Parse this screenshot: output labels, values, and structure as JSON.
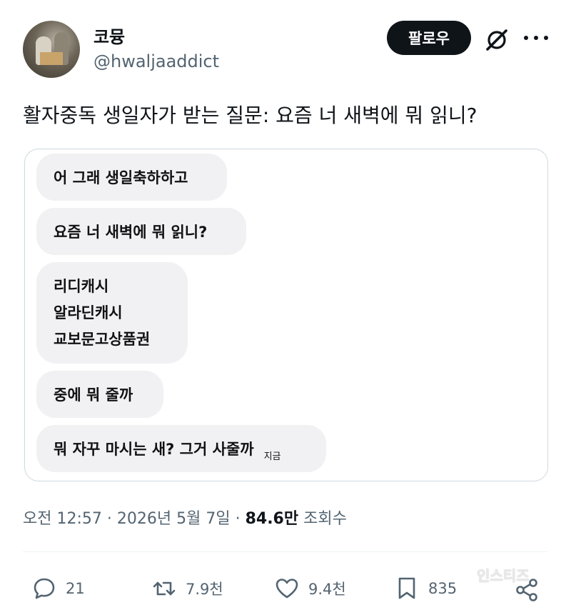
{
  "user": {
    "name": "코뮹",
    "handle": "@hwaljaaddict"
  },
  "header": {
    "follow_label": "팔로우"
  },
  "tweet": {
    "text": "활자중독 생일자가 받는 질문: 요즘 너 새벽에 뭐 읽니?"
  },
  "chat": {
    "msg1": "어 그래 생일축하하고",
    "msg2": "요즘 너 새벽에 뭐 읽니?",
    "msg3_lines": [
      "리디캐시",
      "알라딘캐시",
      "교보문고상품권"
    ],
    "msg4": "중에 뭐 줄까",
    "msg5": "뭐 자꾸 마시는 새? 그거 사줄까",
    "msg5_time": "지금"
  },
  "meta": {
    "time": "오전 12:57",
    "sep1": "·",
    "date": "2026년 5월 7일",
    "sep2": "·",
    "views_count": "84.6만",
    "views_label": "조회수"
  },
  "actions": {
    "replies": "21",
    "reposts": "7.9천",
    "likes": "9.4천",
    "bookmarks": "835"
  },
  "watermark": "인스티즈",
  "colors": {
    "text": "#0f1419",
    "muted": "#536471",
    "bubble": "#f1f1f3",
    "border": "#cfd9de"
  }
}
